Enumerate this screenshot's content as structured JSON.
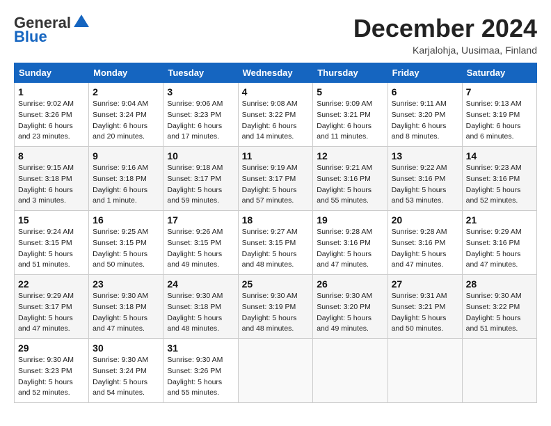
{
  "header": {
    "logo_general": "General",
    "logo_blue": "Blue",
    "month_title": "December 2024",
    "location": "Karjalohja, Uusimaa, Finland"
  },
  "days_of_week": [
    "Sunday",
    "Monday",
    "Tuesday",
    "Wednesday",
    "Thursday",
    "Friday",
    "Saturday"
  ],
  "weeks": [
    [
      {
        "day": "1",
        "sunrise": "Sunrise: 9:02 AM",
        "sunset": "Sunset: 3:26 PM",
        "daylight": "Daylight: 6 hours and 23 minutes."
      },
      {
        "day": "2",
        "sunrise": "Sunrise: 9:04 AM",
        "sunset": "Sunset: 3:24 PM",
        "daylight": "Daylight: 6 hours and 20 minutes."
      },
      {
        "day": "3",
        "sunrise": "Sunrise: 9:06 AM",
        "sunset": "Sunset: 3:23 PM",
        "daylight": "Daylight: 6 hours and 17 minutes."
      },
      {
        "day": "4",
        "sunrise": "Sunrise: 9:08 AM",
        "sunset": "Sunset: 3:22 PM",
        "daylight": "Daylight: 6 hours and 14 minutes."
      },
      {
        "day": "5",
        "sunrise": "Sunrise: 9:09 AM",
        "sunset": "Sunset: 3:21 PM",
        "daylight": "Daylight: 6 hours and 11 minutes."
      },
      {
        "day": "6",
        "sunrise": "Sunrise: 9:11 AM",
        "sunset": "Sunset: 3:20 PM",
        "daylight": "Daylight: 6 hours and 8 minutes."
      },
      {
        "day": "7",
        "sunrise": "Sunrise: 9:13 AM",
        "sunset": "Sunset: 3:19 PM",
        "daylight": "Daylight: 6 hours and 6 minutes."
      }
    ],
    [
      {
        "day": "8",
        "sunrise": "Sunrise: 9:15 AM",
        "sunset": "Sunset: 3:18 PM",
        "daylight": "Daylight: 6 hours and 3 minutes."
      },
      {
        "day": "9",
        "sunrise": "Sunrise: 9:16 AM",
        "sunset": "Sunset: 3:18 PM",
        "daylight": "Daylight: 6 hours and 1 minute."
      },
      {
        "day": "10",
        "sunrise": "Sunrise: 9:18 AM",
        "sunset": "Sunset: 3:17 PM",
        "daylight": "Daylight: 5 hours and 59 minutes."
      },
      {
        "day": "11",
        "sunrise": "Sunrise: 9:19 AM",
        "sunset": "Sunset: 3:17 PM",
        "daylight": "Daylight: 5 hours and 57 minutes."
      },
      {
        "day": "12",
        "sunrise": "Sunrise: 9:21 AM",
        "sunset": "Sunset: 3:16 PM",
        "daylight": "Daylight: 5 hours and 55 minutes."
      },
      {
        "day": "13",
        "sunrise": "Sunrise: 9:22 AM",
        "sunset": "Sunset: 3:16 PM",
        "daylight": "Daylight: 5 hours and 53 minutes."
      },
      {
        "day": "14",
        "sunrise": "Sunrise: 9:23 AM",
        "sunset": "Sunset: 3:16 PM",
        "daylight": "Daylight: 5 hours and 52 minutes."
      }
    ],
    [
      {
        "day": "15",
        "sunrise": "Sunrise: 9:24 AM",
        "sunset": "Sunset: 3:15 PM",
        "daylight": "Daylight: 5 hours and 51 minutes."
      },
      {
        "day": "16",
        "sunrise": "Sunrise: 9:25 AM",
        "sunset": "Sunset: 3:15 PM",
        "daylight": "Daylight: 5 hours and 50 minutes."
      },
      {
        "day": "17",
        "sunrise": "Sunrise: 9:26 AM",
        "sunset": "Sunset: 3:15 PM",
        "daylight": "Daylight: 5 hours and 49 minutes."
      },
      {
        "day": "18",
        "sunrise": "Sunrise: 9:27 AM",
        "sunset": "Sunset: 3:15 PM",
        "daylight": "Daylight: 5 hours and 48 minutes."
      },
      {
        "day": "19",
        "sunrise": "Sunrise: 9:28 AM",
        "sunset": "Sunset: 3:16 PM",
        "daylight": "Daylight: 5 hours and 47 minutes."
      },
      {
        "day": "20",
        "sunrise": "Sunrise: 9:28 AM",
        "sunset": "Sunset: 3:16 PM",
        "daylight": "Daylight: 5 hours and 47 minutes."
      },
      {
        "day": "21",
        "sunrise": "Sunrise: 9:29 AM",
        "sunset": "Sunset: 3:16 PM",
        "daylight": "Daylight: 5 hours and 47 minutes."
      }
    ],
    [
      {
        "day": "22",
        "sunrise": "Sunrise: 9:29 AM",
        "sunset": "Sunset: 3:17 PM",
        "daylight": "Daylight: 5 hours and 47 minutes."
      },
      {
        "day": "23",
        "sunrise": "Sunrise: 9:30 AM",
        "sunset": "Sunset: 3:18 PM",
        "daylight": "Daylight: 5 hours and 47 minutes."
      },
      {
        "day": "24",
        "sunrise": "Sunrise: 9:30 AM",
        "sunset": "Sunset: 3:18 PM",
        "daylight": "Daylight: 5 hours and 48 minutes."
      },
      {
        "day": "25",
        "sunrise": "Sunrise: 9:30 AM",
        "sunset": "Sunset: 3:19 PM",
        "daylight": "Daylight: 5 hours and 48 minutes."
      },
      {
        "day": "26",
        "sunrise": "Sunrise: 9:30 AM",
        "sunset": "Sunset: 3:20 PM",
        "daylight": "Daylight: 5 hours and 49 minutes."
      },
      {
        "day": "27",
        "sunrise": "Sunrise: 9:31 AM",
        "sunset": "Sunset: 3:21 PM",
        "daylight": "Daylight: 5 hours and 50 minutes."
      },
      {
        "day": "28",
        "sunrise": "Sunrise: 9:30 AM",
        "sunset": "Sunset: 3:22 PM",
        "daylight": "Daylight: 5 hours and 51 minutes."
      }
    ],
    [
      {
        "day": "29",
        "sunrise": "Sunrise: 9:30 AM",
        "sunset": "Sunset: 3:23 PM",
        "daylight": "Daylight: 5 hours and 52 minutes."
      },
      {
        "day": "30",
        "sunrise": "Sunrise: 9:30 AM",
        "sunset": "Sunset: 3:24 PM",
        "daylight": "Daylight: 5 hours and 54 minutes."
      },
      {
        "day": "31",
        "sunrise": "Sunrise: 9:30 AM",
        "sunset": "Sunset: 3:26 PM",
        "daylight": "Daylight: 5 hours and 55 minutes."
      },
      null,
      null,
      null,
      null
    ]
  ]
}
